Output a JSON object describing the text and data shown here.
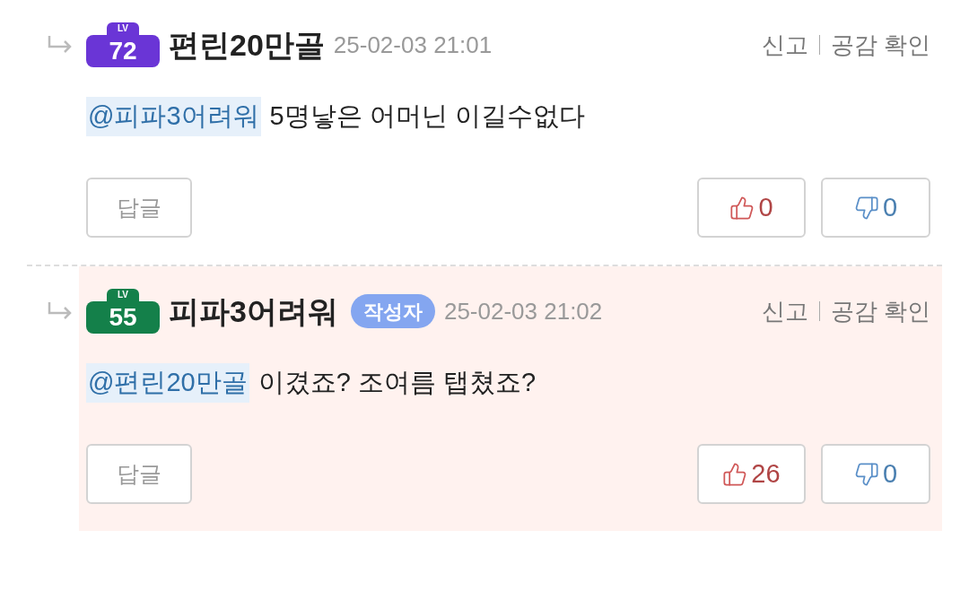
{
  "comments": [
    {
      "highlighted": false,
      "level": {
        "tag": "LV",
        "number": "72",
        "color": "#6a35d6"
      },
      "author": "편린20만골",
      "time": "25-02-03 21:01",
      "report": "신고",
      "empathy": "공감 확인",
      "mention": "@피파3어려워",
      "text": "5명낳은 어머닌 이길수없다",
      "reply_button": "답글",
      "likes": "0",
      "dislikes": "0"
    },
    {
      "highlighted": true,
      "level": {
        "tag": "LV",
        "number": "55",
        "color": "#14804a"
      },
      "author": "피파3어려워",
      "author_badge": "작성자",
      "time": "25-02-03 21:02",
      "report": "신고",
      "empathy": "공감 확인",
      "mention": "@편린20만골",
      "text": "이겼죠? 조여름 탭쳤죠?",
      "reply_button": "답글",
      "likes": "26",
      "dislikes": "0"
    }
  ]
}
